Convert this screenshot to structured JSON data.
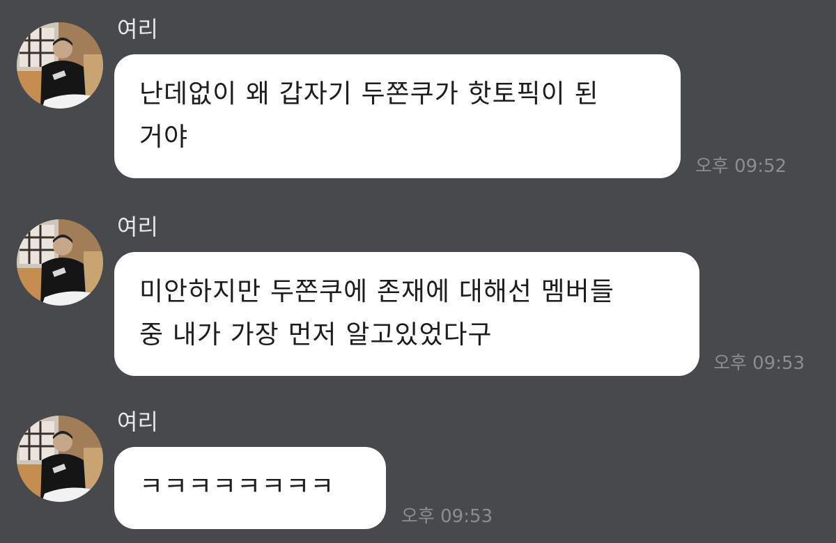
{
  "messages": [
    {
      "sender": "여리",
      "lines": [
        "난데없이 왜 갑자기 두쫀쿠가 핫토픽이 된",
        "거야"
      ],
      "time": "오후 09:52"
    },
    {
      "sender": "여리",
      "lines": [
        "미안하지만 두쫀쿠에 존재에 대해선 멤버들",
        "중 내가 가장 먼저 알고있었다구"
      ],
      "time": "오후 09:53"
    },
    {
      "sender": "여리",
      "lines": [
        "ㅋㅋㅋㅋㅋㅋㅋㅋ"
      ],
      "time": "오후 09:53"
    }
  ],
  "colors": {
    "background": "#48494c",
    "bubble": "#ffffff",
    "name_text": "#e8e8e8",
    "time_text": "#8c8d90"
  },
  "icons": {
    "avatar": "profile-photo-avatar"
  }
}
